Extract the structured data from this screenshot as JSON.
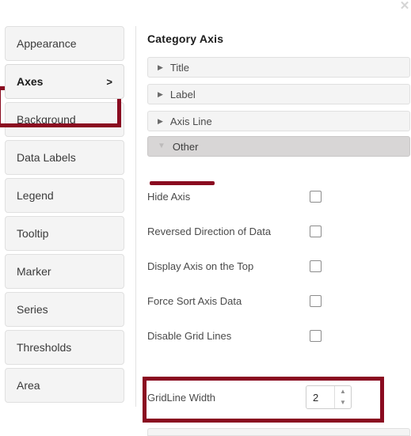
{
  "window": {
    "close_icon": "✕"
  },
  "sidebar": {
    "items": [
      {
        "label": "Appearance",
        "selected": false,
        "chevron": ""
      },
      {
        "label": "Axes",
        "selected": true,
        "chevron": ">"
      },
      {
        "label": "Background",
        "selected": false,
        "chevron": ""
      },
      {
        "label": "Data Labels",
        "selected": false,
        "chevron": ""
      },
      {
        "label": "Legend",
        "selected": false,
        "chevron": ""
      },
      {
        "label": "Tooltip",
        "selected": false,
        "chevron": ""
      },
      {
        "label": "Marker",
        "selected": false,
        "chevron": ""
      },
      {
        "label": "Series",
        "selected": false,
        "chevron": ""
      },
      {
        "label": "Thresholds",
        "selected": false,
        "chevron": ""
      },
      {
        "label": "Area",
        "selected": false,
        "chevron": ""
      }
    ]
  },
  "panel": {
    "title": "Category Axis",
    "accordions": [
      {
        "label": "Title",
        "expanded": false,
        "arrow": "▶"
      },
      {
        "label": "Label",
        "expanded": false,
        "arrow": "▶"
      },
      {
        "label": "Axis Line",
        "expanded": false,
        "arrow": "▶"
      },
      {
        "label": "Other",
        "expanded": true,
        "arrow": "▼"
      }
    ],
    "options": [
      {
        "label": "Hide Axis",
        "checked": false
      },
      {
        "label": "Reversed Direction of Data",
        "checked": false
      },
      {
        "label": "Display Axis on the Top",
        "checked": false
      },
      {
        "label": "Force Sort Axis Data",
        "checked": false
      },
      {
        "label": "Disable Grid Lines",
        "checked": false
      }
    ],
    "gridline_width": {
      "label": "GridLine Width",
      "value": "2",
      "increment_icon": "▲",
      "decrement_icon": "▼"
    }
  },
  "colors": {
    "highlight": "#8a0b20",
    "panel_bg": "#f4f4f4",
    "expanded_bg": "#d8d6d6"
  }
}
